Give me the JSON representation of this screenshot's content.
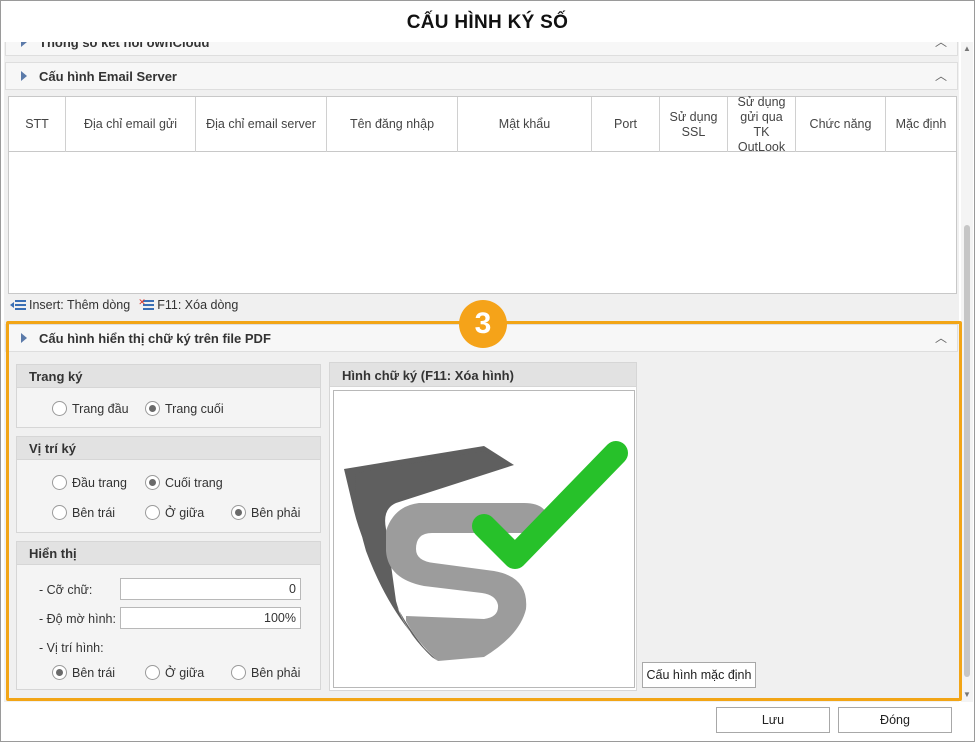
{
  "window": {
    "title": "CẤU HÌNH KÝ SỐ"
  },
  "groups": {
    "cloud": {
      "label": "Thông số kết nối ownCloud"
    },
    "email": {
      "label": "Cấu hình Email Server"
    },
    "pdf": {
      "label": "Cấu hình hiển thị chữ ký trên file PDF"
    }
  },
  "email_grid": {
    "columns": [
      "STT",
      "Địa chỉ email gửi",
      "Địa chỉ email server",
      "Tên đăng nhập",
      "Mật khẩu",
      "Port",
      "Sử dụng SSL",
      "Sử dụng gửi qua TK OutLook",
      "Chức năng",
      "Mặc định"
    ],
    "rows": []
  },
  "grid_toolbar": {
    "insert": "Insert: Thêm dòng",
    "delete": "F11: Xóa dòng"
  },
  "step_badge": "3",
  "page_sign": {
    "title": "Trang ký",
    "options": [
      "Trang đầu",
      "Trang cuối"
    ],
    "selected": "Trang cuối"
  },
  "position": {
    "title": "Vị trí ký",
    "vertical_options": [
      "Đầu trang",
      "Cuối trang"
    ],
    "vertical_selected": "Cuối trang",
    "horizontal_options": [
      "Bên trái",
      "Ở giữa",
      "Bên phải"
    ],
    "horizontal_selected": "Bên phải"
  },
  "display": {
    "title": "Hiển thị",
    "font_size_label": "- Cỡ chữ:",
    "font_size_value": "0",
    "opacity_label": "- Độ mờ hình:",
    "opacity_value": "100%",
    "image_position_label": "- Vị trí hình:",
    "image_position_options": [
      "Bên trái",
      "Ở giữa",
      "Bên phải"
    ],
    "image_position_selected": "Bên trái"
  },
  "signature_image": {
    "title": "Hình chữ ký (F11: Xóa hình)",
    "logo_colors": {
      "shield_dark": "#5f5f5f",
      "shield_light": "#9c9c9c",
      "check": "#27c12a"
    }
  },
  "buttons": {
    "default_config": "Cấu hình mặc định",
    "save": "Lưu",
    "close": "Đóng"
  },
  "colors": {
    "highlight": "#f2a516",
    "badge": "#f5a319"
  }
}
